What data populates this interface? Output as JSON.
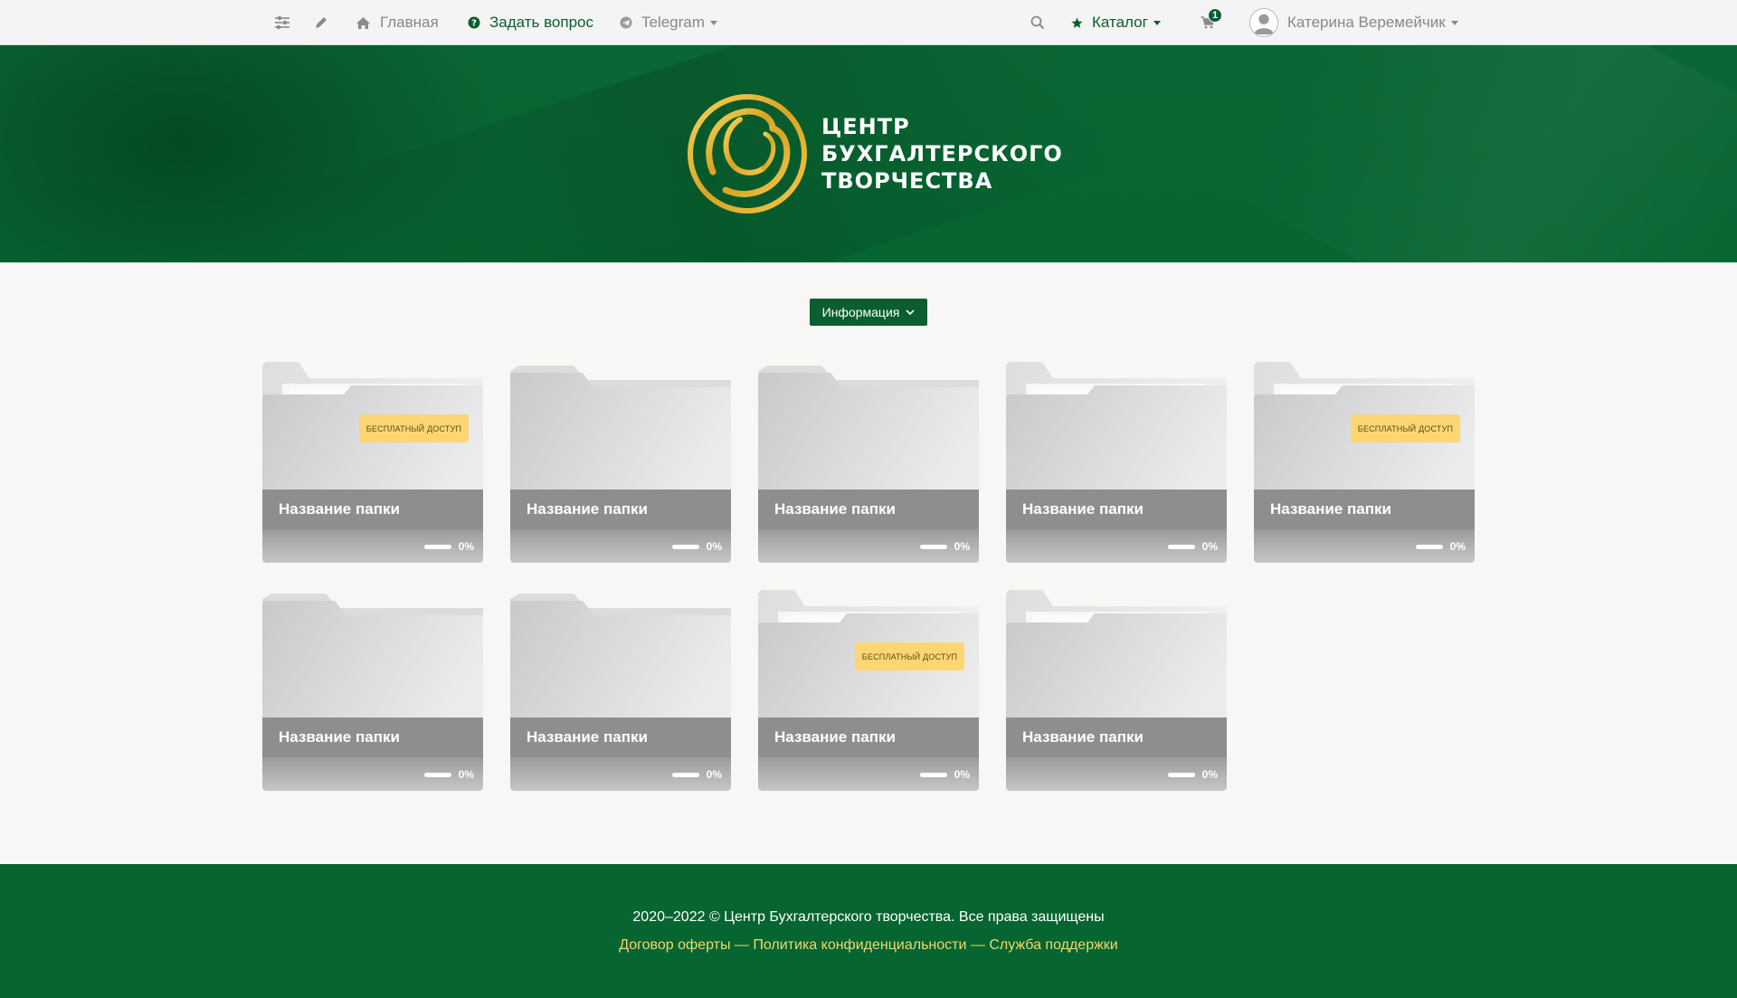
{
  "nav": {
    "home_label": "Главная",
    "ask_label": "Задать вопрос",
    "telegram_label": "Telegram",
    "catalog_label": "Каталог",
    "cart_count": "1",
    "user_name": "Катерина Веремейчик",
    "icons": [
      "sliders-icon",
      "pencil-icon",
      "home-icon",
      "question-circle-icon",
      "telegram-icon",
      "search-icon",
      "star-icon",
      "cart-icon",
      "user-avatar-icon"
    ]
  },
  "hero": {
    "logo_line1": "ЦЕНТР",
    "logo_line2": "БУХГАЛТЕРСКОГО",
    "logo_line3": "ТВОРЧЕСТВА"
  },
  "info_button": {
    "label": "Информация"
  },
  "folders": [
    {
      "title": "Название папки",
      "badge": "БЕСПЛАТНЫЙ ДОСТУП",
      "progress_text": "0%",
      "progress": 0
    },
    {
      "title": "Название папки",
      "badge": "",
      "progress_text": "0%",
      "progress": 0
    },
    {
      "title": "Название папки",
      "badge": "",
      "progress_text": "0%",
      "progress": 0
    },
    {
      "title": "Название папки",
      "badge": "",
      "progress_text": "0%",
      "progress": 0
    },
    {
      "title": "Название папки",
      "badge": "БЕСПЛАТНЫЙ ДОСТУП",
      "progress_text": "0%",
      "progress": 0
    },
    {
      "title": "Название папки",
      "badge": "",
      "progress_text": "0%",
      "progress": 0
    },
    {
      "title": "Название папки",
      "badge": "",
      "progress_text": "0%",
      "progress": 0
    },
    {
      "title": "Название папки",
      "badge": "БЕСПЛАТНЫЙ ДОСТУП",
      "progress_text": "0%",
      "progress": 0
    },
    {
      "title": "Название папки",
      "badge": "",
      "progress_text": "0%",
      "progress": 0
    }
  ],
  "footer": {
    "copyright": "2020–2022 © Центр Бухгалтерского творчества. Все права защищены",
    "offer_link": "Договор оферты",
    "privacy_link": "Политика конфиденциальности",
    "support_link": "Служба поддержки",
    "separator": "—"
  },
  "colors": {
    "brand_green": "#0b5e2f",
    "hero_green": "#066531",
    "badge_yellow": "#fcd673",
    "footer_link": "#f0d86a"
  }
}
